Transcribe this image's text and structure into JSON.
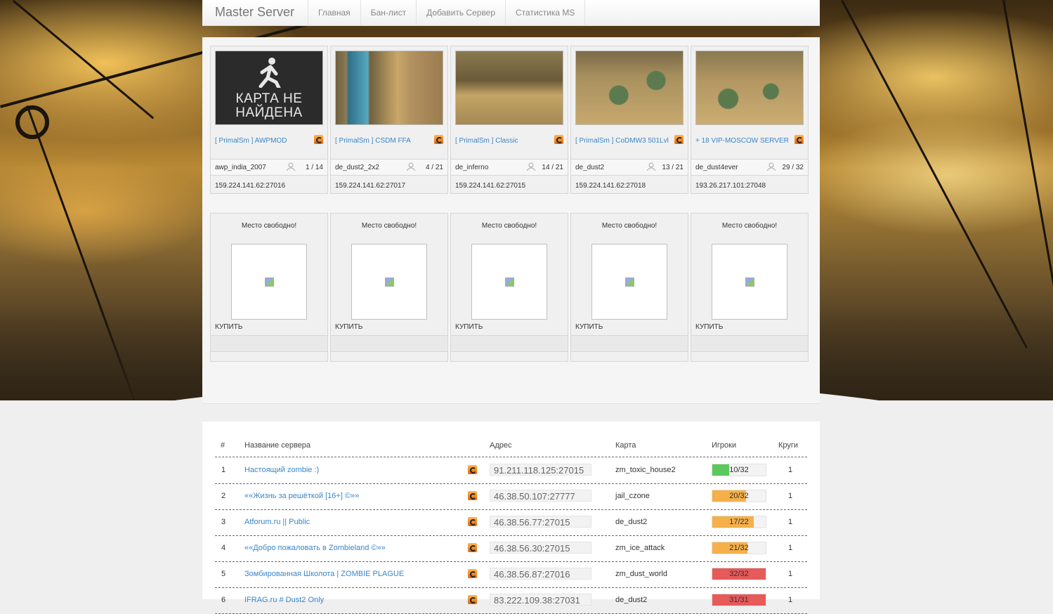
{
  "nav": {
    "brand": "Master Server",
    "items": [
      "Главная",
      "Бан-лист",
      "Добавить Сервер",
      "Статистика MS"
    ]
  },
  "featured": [
    {
      "image": "no-map",
      "no_map_line1": "КАРТА НЕ",
      "no_map_line2": "НАЙДЕНА",
      "name": "[ PrimalSm ] AWPMOD",
      "map": "awp_india_2007",
      "players": "1 / 14",
      "address": "159.224.141.62:27016"
    },
    {
      "image": "map-screenshot",
      "name": "[ PrimalSm ] CSDM FFA",
      "map": "de_dust2_2x2",
      "players": "4 / 21",
      "address": "159.224.141.62:27017"
    },
    {
      "image": "map-screenshot",
      "name": "[ PrimalSm ] Classic",
      "map": "de_inferno",
      "players": "14 / 21",
      "address": "159.224.141.62:27015"
    },
    {
      "image": "map-screenshot",
      "name": "[ PrimalSm ] CoDMW3 501Lvl",
      "map": "de_dust2",
      "players": "13 / 21",
      "address": "159.224.141.62:27018"
    },
    {
      "image": "map-screenshot",
      "name": "+ 18 VIP-MOSCOW SERVER",
      "map": "de_dust4ever",
      "players": "29 / 32",
      "address": "193.26.217.101:27048"
    }
  ],
  "free_slots": [
    {
      "title": "Место свободно!",
      "buy": "КУПИТЬ"
    },
    {
      "title": "Место свободно!",
      "buy": "КУПИТЬ"
    },
    {
      "title": "Место свободно!",
      "buy": "КУПИТЬ"
    },
    {
      "title": "Место свободно!",
      "buy": "КУПИТЬ"
    },
    {
      "title": "Место свободно!",
      "buy": "КУПИТЬ"
    }
  ],
  "table": {
    "headers": {
      "num": "#",
      "name": "Название сервера",
      "address": "Адрес",
      "map": "Карта",
      "players": "Игроки",
      "rounds": "Круги"
    },
    "rows": [
      {
        "num": "1",
        "name": "Настоящий zombie :)",
        "address": "91.211.118.125:27015",
        "map": "zm_toxic_house2",
        "players": "10/32",
        "fill": 0.3125,
        "color": "#5bc85b",
        "rounds": "1"
      },
      {
        "num": "2",
        "name": "««Жизнь за решёткой [16+] ©»»",
        "address": "46.38.50.107:27777",
        "map": "jail_czone",
        "players": "20/32",
        "fill": 0.625,
        "color": "#f5b04a",
        "rounds": "1"
      },
      {
        "num": "3",
        "name": "Atforum.ru || Public",
        "address": "46.38.56.77:27015",
        "map": "de_dust2",
        "players": "17/22",
        "fill": 0.7727,
        "color": "#f5b04a",
        "rounds": "1"
      },
      {
        "num": "4",
        "name": "««Добро пожаловать в Zombieland ©»»",
        "address": "46.38.56.30:27015",
        "map": "zm_ice_attack",
        "players": "21/32",
        "fill": 0.6563,
        "color": "#f5b04a",
        "rounds": "1"
      },
      {
        "num": "5",
        "name": "Зомбированная Школота | ZOMBIE PLAGUE",
        "address": "46.38.56.87:27016",
        "map": "zm_dust_world",
        "players": "32/32",
        "fill": 1.0,
        "color": "#e65a5a",
        "rounds": "1"
      },
      {
        "num": "6",
        "name": "IFRAG.ru # Dust2 Only",
        "address": "83.222.109.38:27031",
        "map": "de_dust2",
        "players": "31/31",
        "fill": 1.0,
        "color": "#e65a5a",
        "rounds": "1"
      }
    ]
  }
}
